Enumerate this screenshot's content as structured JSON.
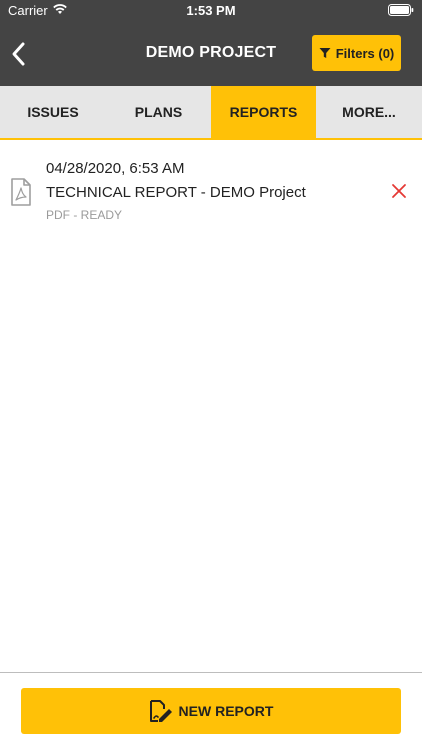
{
  "status_bar": {
    "carrier": "Carrier",
    "time": "1:53 PM"
  },
  "nav": {
    "title": "DEMO PROJECT",
    "filters_label": "Filters (0)"
  },
  "tabs": [
    {
      "label": "ISSUES",
      "active": false
    },
    {
      "label": "PLANS",
      "active": false
    },
    {
      "label": "REPORTS",
      "active": true
    },
    {
      "label": "MORE...",
      "active": false
    }
  ],
  "reports": [
    {
      "date": "04/28/2020, 6:53 AM",
      "title": "TECHNICAL REPORT - DEMO Project",
      "status": "PDF - READY",
      "icon": "pdf-file-icon"
    }
  ],
  "footer": {
    "new_report_label": "NEW REPORT",
    "icon": "edit-document-icon"
  },
  "colors": {
    "accent": "#ffc107",
    "header": "#444444",
    "delete": "#e53935"
  }
}
